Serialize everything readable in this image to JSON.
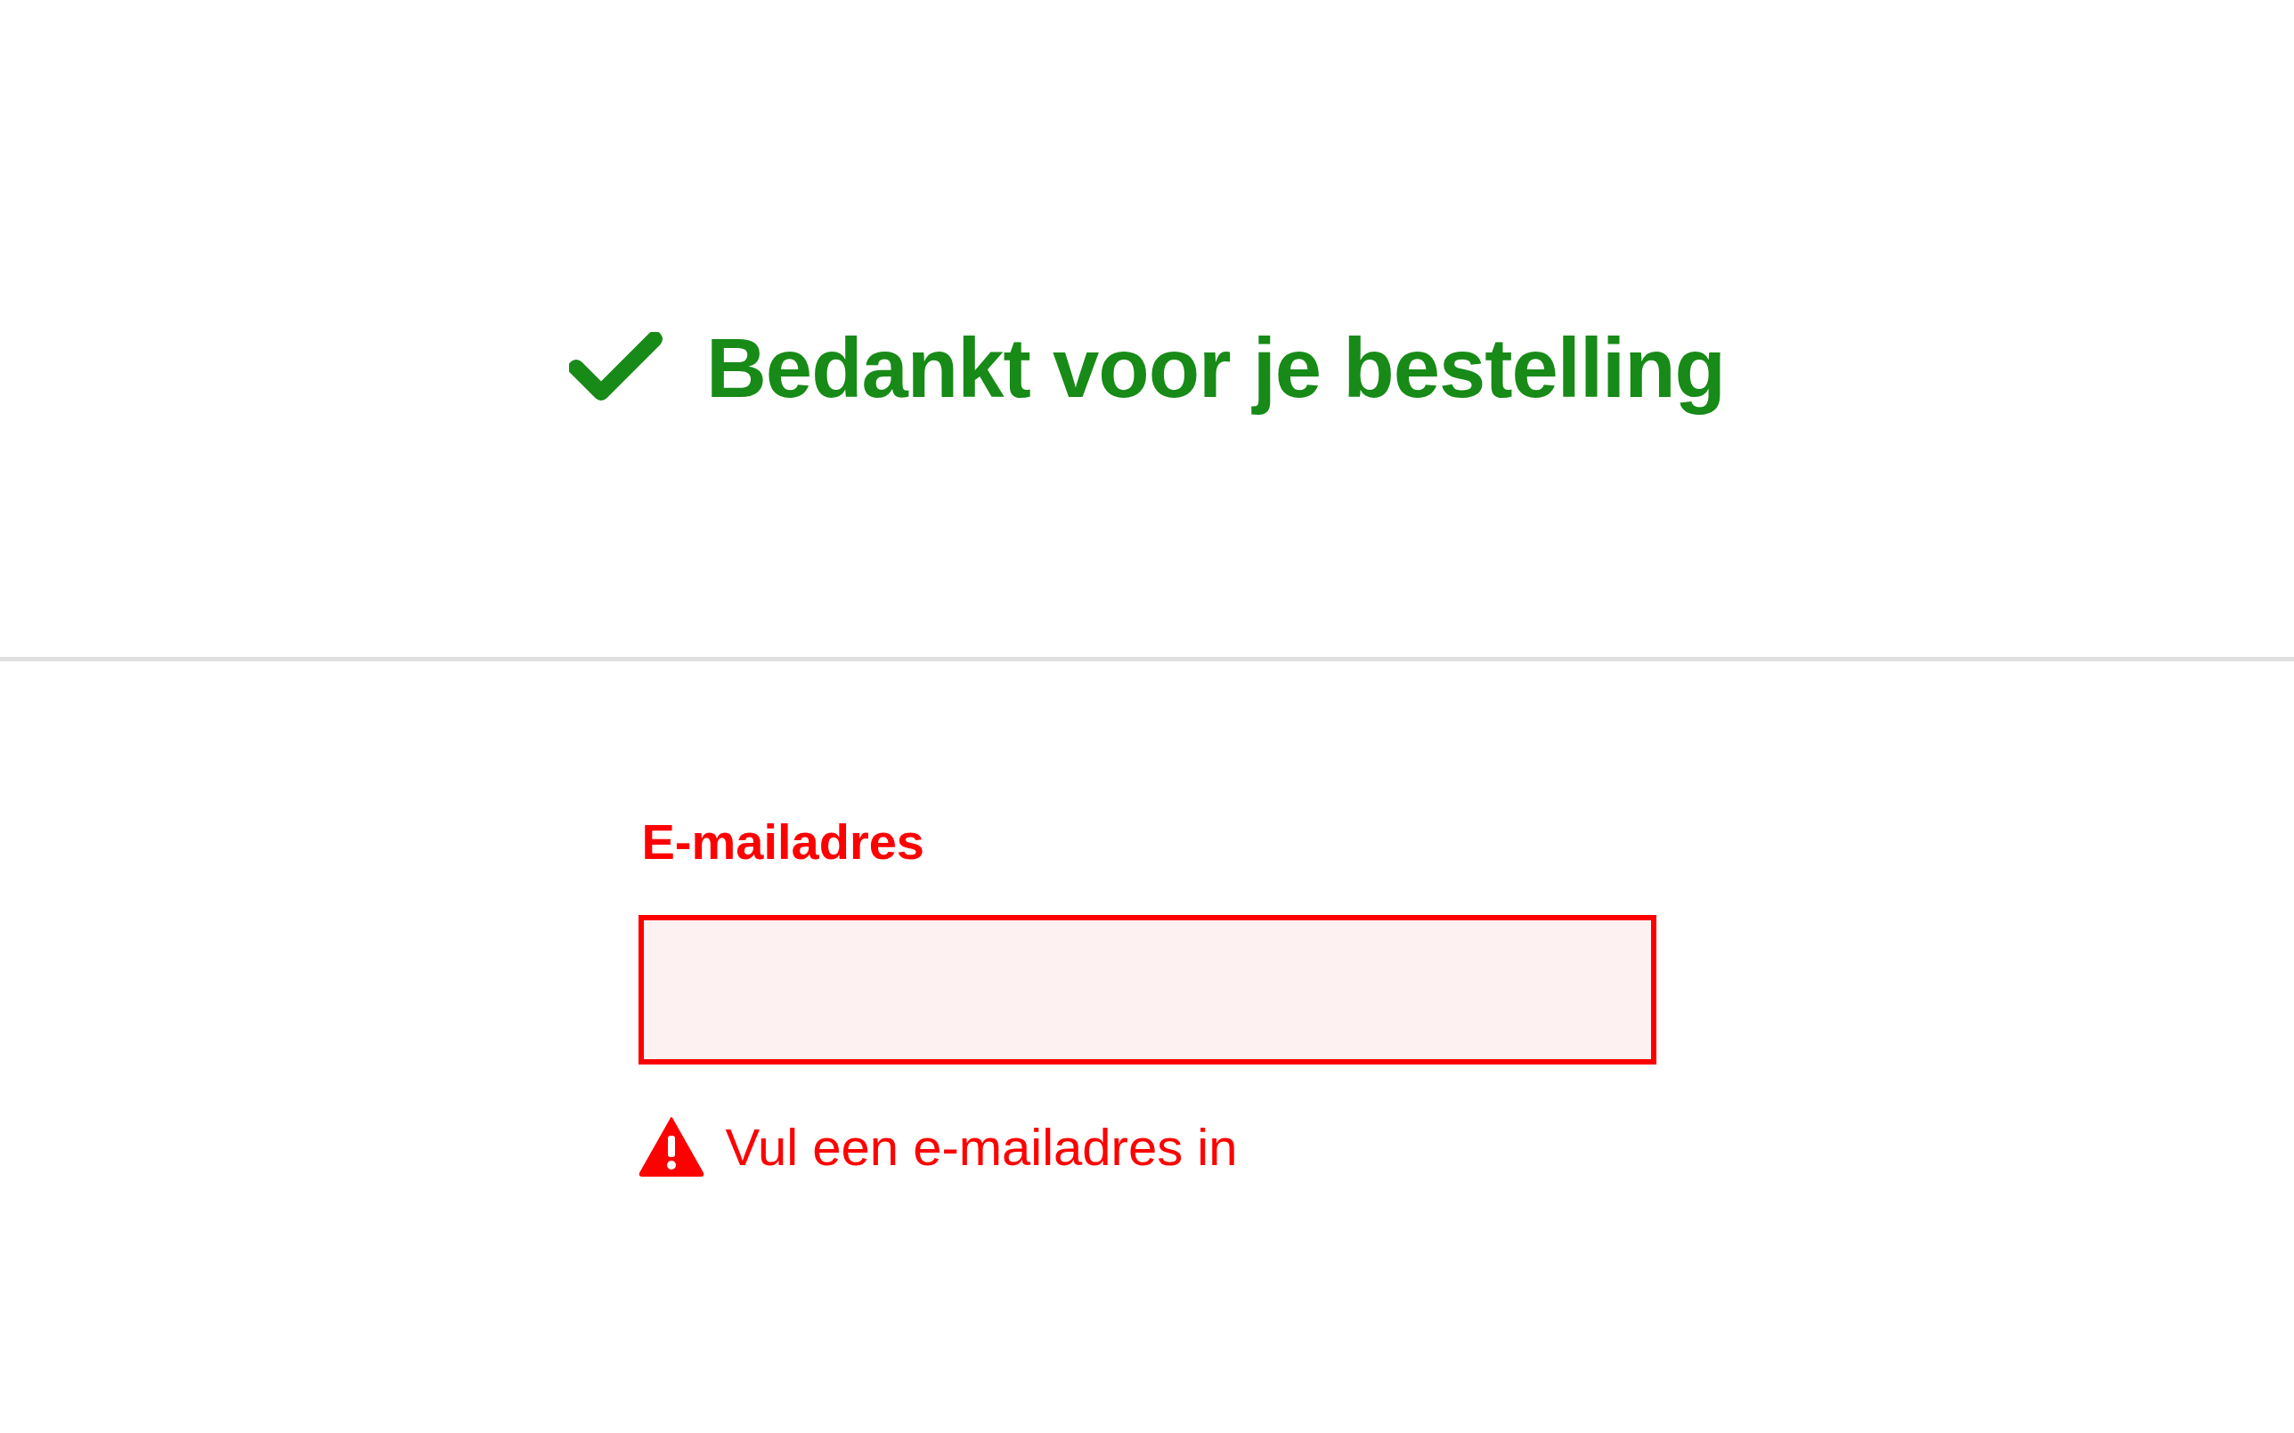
{
  "confirmation": {
    "kind": "success",
    "text": "Bedankt voor je bestelling"
  },
  "email_field": {
    "label": "E-mailadres",
    "invalid": true,
    "error": "Vul een e-mailadres in"
  }
}
